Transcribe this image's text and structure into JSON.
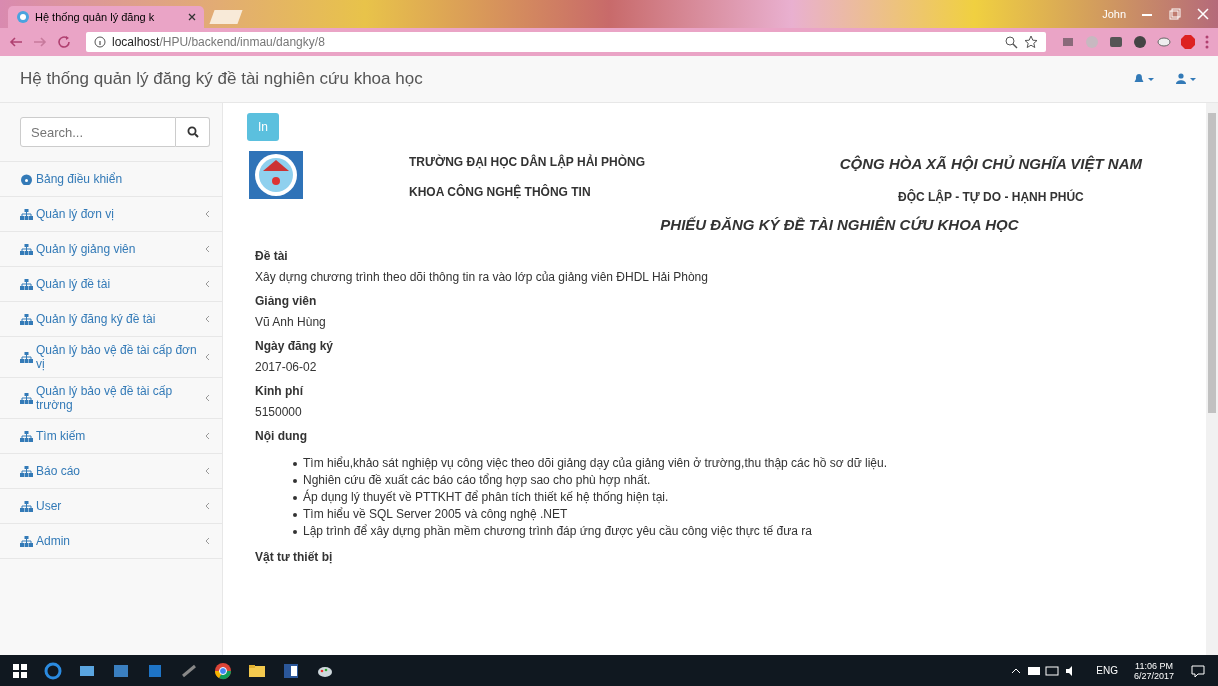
{
  "browser": {
    "tab_title": "Hệ thống quản lý đăng k",
    "user": "John",
    "url_host": "localhost",
    "url_path": "/HPU/backend/inmau/dangky/8"
  },
  "app": {
    "title": "Hệ thống quản lý đăng ký đề tài nghiên cứu khoa học"
  },
  "sidebar": {
    "search": {
      "placeholder": "Search..."
    },
    "items": [
      {
        "label": "Bảng điều khiển",
        "kind": "dashboard"
      },
      {
        "label": "Quản lý đơn vị",
        "kind": "menu"
      },
      {
        "label": "Quản lý giảng viên",
        "kind": "menu"
      },
      {
        "label": "Quản lý đề tài",
        "kind": "menu"
      },
      {
        "label": "Quản lý đăng ký đề tài",
        "kind": "menu"
      },
      {
        "label": "Quản lý bảo vệ đề tài cấp đơn vị",
        "kind": "menu"
      },
      {
        "label": "Quản lý bảo vệ đề tài cấp trường",
        "kind": "menu"
      },
      {
        "label": "Tìm kiếm",
        "kind": "menu"
      },
      {
        "label": "Báo cáo",
        "kind": "menu"
      },
      {
        "label": "User",
        "kind": "menu"
      },
      {
        "label": "Admin",
        "kind": "menu"
      }
    ]
  },
  "document": {
    "print_button": "In",
    "school": "TRƯỜNG ĐẠI HỌC DÂN LẬP HẢI PHÒNG",
    "faculty": "KHOA CÔNG NGHỆ THÔNG TIN",
    "nation": "CỘNG HÒA XÃ HỘI CHỦ NGHĨA VIỆT NAM",
    "motto": "ĐỘC LẬP - TỰ DO - HẠNH PHÚC",
    "title": "PHIẾU ĐĂNG KÝ ĐỀ TÀI NGHIÊN CỨU KHOA HỌC",
    "fields": [
      {
        "label": "Đề tài",
        "value": "Xây dựng chương trình theo dõi thông tin ra vào lớp của giảng viên ĐHDL Hải Phòng"
      },
      {
        "label": "Giảng viên",
        "value": "Vũ Anh Hùng"
      },
      {
        "label": "Ngày đăng ký",
        "value": "2017-06-02"
      },
      {
        "label": "Kinh phí",
        "value": "5150000"
      }
    ],
    "content_label": "Nội dung",
    "content_items": [
      "Tìm hiểu,khảo sát nghiệp vụ công việc theo dõi giảng dạy của giảng viên ở trường,thu thập các hồ sơ dữ liệu.",
      "Nghiên cứu đề xuất các báo cáo tổng hợp sao cho phù hợp nhất.",
      "Áp dụng lý thuyết về PTTKHT để phân tích thiết kế hệ thống hiện tại.",
      "Tìm hiểu về SQL Server 2005 và công nghệ .NET",
      "Lập trình để xây dựng phần mềm chương trình đáp ứng được yêu cầu công việc thực tế đưa ra"
    ],
    "equipment_label": "Vật tư thiết bị"
  },
  "taskbar": {
    "language": "ENG",
    "time": "11:06 PM",
    "date": "6/27/2017"
  }
}
